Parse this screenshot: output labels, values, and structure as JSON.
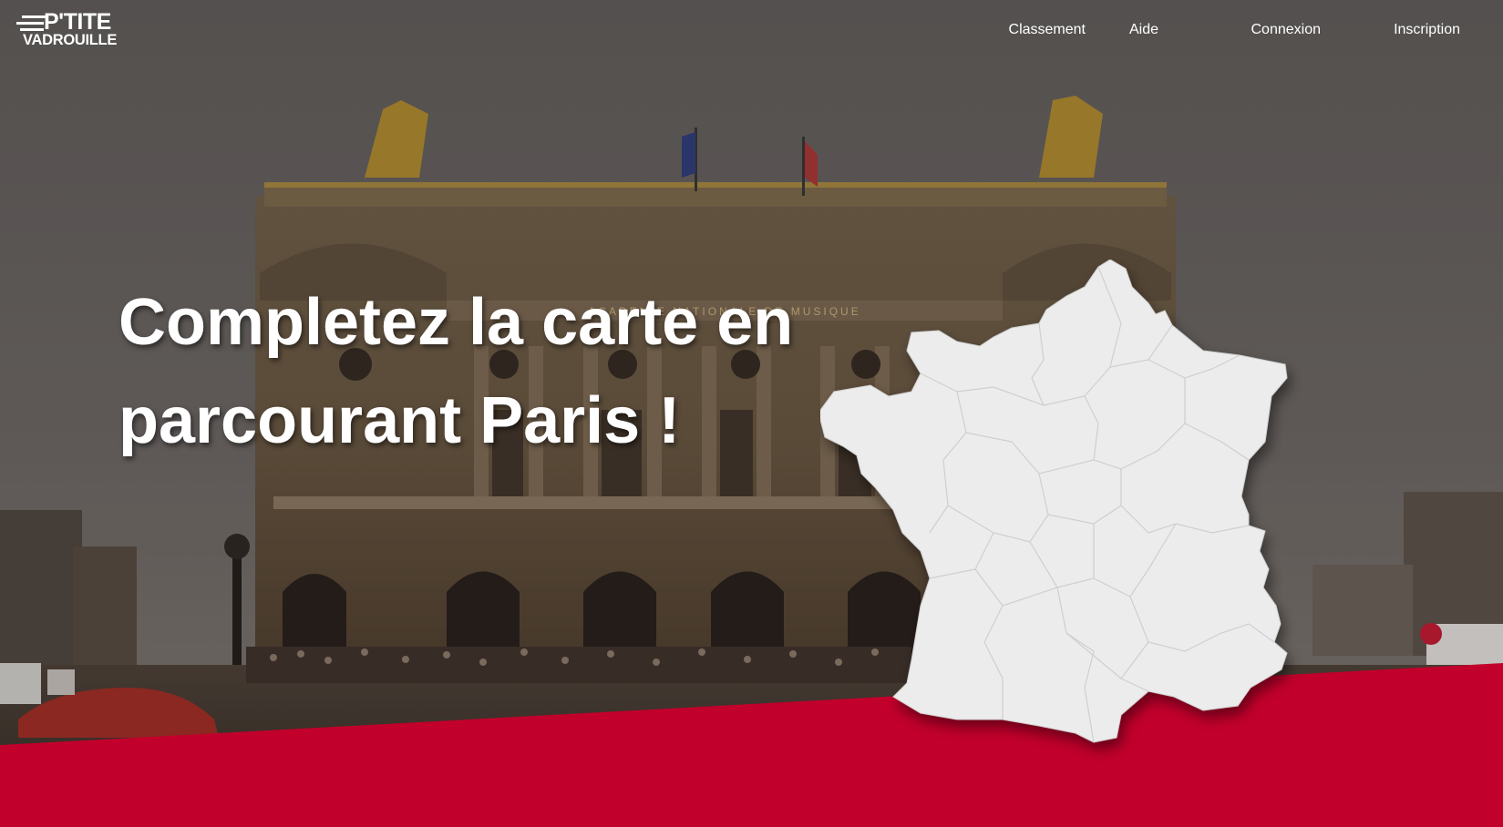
{
  "brand": {
    "line1": "P'TITE",
    "line2": "VADROUILLE"
  },
  "nav": {
    "items": [
      {
        "label": "Classement"
      },
      {
        "label": "Aide"
      },
      {
        "label": "Connexion"
      },
      {
        "label": "Inscription"
      }
    ]
  },
  "hero": {
    "headline_line1": "Completez la carte en",
    "headline_line2": "parcourant Paris !",
    "building_inscription": "ACADEMIE NATIONALE DE MUSIQUE"
  },
  "colors": {
    "accent_red": "#c1002b",
    "map_fill": "#ececec",
    "text": "#ffffff"
  },
  "icons": {
    "logo_speed_lines": "speed-lines-icon"
  }
}
